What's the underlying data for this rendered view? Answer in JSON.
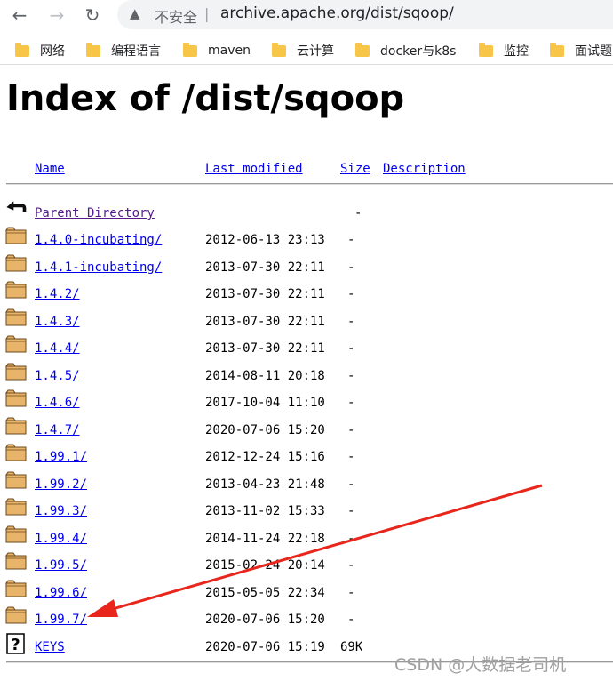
{
  "browser": {
    "security_label": "不安全",
    "separator": "|",
    "url": "archive.apache.org/dist/sqoop/",
    "bookmarks": [
      {
        "label": "网络"
      },
      {
        "label": "编程语言"
      },
      {
        "label": "maven"
      },
      {
        "label": "云计算"
      },
      {
        "label": "docker与k8s"
      },
      {
        "label": "监控"
      },
      {
        "label": "面试题"
      }
    ]
  },
  "page": {
    "title": "Index of /dist/sqoop",
    "headers": {
      "name": "Name",
      "last_modified": "Last modified",
      "size": "Size",
      "description": "Description"
    },
    "parent": {
      "name": "Parent Directory",
      "size": "-"
    },
    "entries": [
      {
        "name": "1.4.0-incubating/",
        "date": "2012-06-13 23:13",
        "size": "-"
      },
      {
        "name": "1.4.1-incubating/",
        "date": "2013-07-30 22:11",
        "size": "-"
      },
      {
        "name": "1.4.2/",
        "date": "2013-07-30 22:11",
        "size": "-"
      },
      {
        "name": "1.4.3/",
        "date": "2013-07-30 22:11",
        "size": "-"
      },
      {
        "name": "1.4.4/",
        "date": "2013-07-30 22:11",
        "size": "-"
      },
      {
        "name": "1.4.5/",
        "date": "2014-08-11 20:18",
        "size": "-"
      },
      {
        "name": "1.4.6/",
        "date": "2017-10-04 11:10",
        "size": "-"
      },
      {
        "name": "1.4.7/",
        "date": "2020-07-06 15:20",
        "size": "-"
      },
      {
        "name": "1.99.1/",
        "date": "2012-12-24 15:16",
        "size": "-"
      },
      {
        "name": "1.99.2/",
        "date": "2013-04-23 21:48",
        "size": "-"
      },
      {
        "name": "1.99.3/",
        "date": "2013-11-02 15:33",
        "size": "-"
      },
      {
        "name": "1.99.4/",
        "date": "2014-11-24 22:18",
        "size": "-"
      },
      {
        "name": "1.99.5/",
        "date": "2015-02-24 20:14",
        "size": "-"
      },
      {
        "name": "1.99.6/",
        "date": "2015-05-05 22:34",
        "size": "-"
      },
      {
        "name": "1.99.7/",
        "date": "2020-07-06 15:20",
        "size": "-"
      },
      {
        "name": "KEYS",
        "date": "2020-07-06 15:19",
        "size": "69K",
        "icon": "unknown-file-icon"
      }
    ]
  },
  "watermark": "CSDN @大数据老司机",
  "colors": {
    "link": "#0000ee",
    "visited_link": "#551a8b",
    "folder": "#f7c548",
    "annotation_arrow": "#e8261c"
  }
}
